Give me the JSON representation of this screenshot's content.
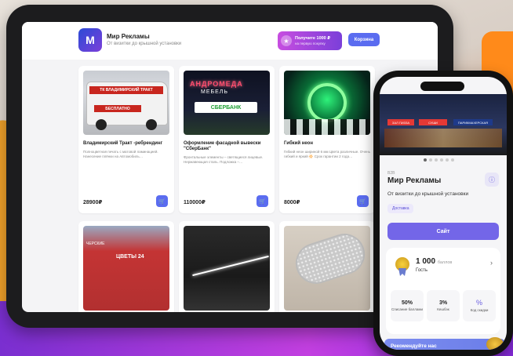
{
  "header": {
    "logo_letter": "М",
    "brand_name": "Мир Рекламы",
    "brand_sub": "От визитки до крышной установки",
    "promo_line1": "Получите 1000 ₽",
    "promo_line2": "на первую покупку",
    "cart_label": "Корзина"
  },
  "products": [
    {
      "title": "Владимирский Тракт -ребрендинг",
      "desc": "Полноцветная печать с матовой ламинацией. Нанесение плёнки на Автомобиль…",
      "price": "28900₽",
      "img_text1": "ТК ВЛАДИМИРСКИЙ ТРАКТ",
      "img_text2": "БЕСПЛАТНО"
    },
    {
      "title": "Оформление фасадной вывески \"СберБанк\"",
      "desc": "Фронтальные элементы – светящиеся лицевые. Нержавеющая сталь. Подложка –…",
      "price": "110000₽",
      "img_text1": "АНДРОМЕДА",
      "img_text2": "МЕБЕЛЬ",
      "img_text3": "СБЕРБАНК"
    },
    {
      "title": "Гибкий неон",
      "desc": "Гибкий неон шириной 6 мм Цвета различные. Очень гибкий и яркий 🔆 Срок гарантии 2 года…",
      "price": "8000₽"
    },
    {
      "title": "",
      "img_text1": "ЦВЕТЫ 24",
      "img_text2": "ЧЕРСКИЕ"
    },
    {
      "title": ""
    },
    {
      "title": ""
    }
  ],
  "phone": {
    "img_signs": [
      "ЗАЛ ПИЗЗА",
      "СУШИ",
      "ПАРИКМАХЕРСКАЯ"
    ],
    "b2b_label": "B2B",
    "name": "Мир Рекламы",
    "subtitle": "От визитки до крышной установки",
    "tag": "Доставка",
    "site_button": "Сайт",
    "points_value": "1 000",
    "points_unit": "баллов",
    "points_level": "Гость",
    "tiles": [
      {
        "value": "50%",
        "label": "Списание баллами"
      },
      {
        "value": "3%",
        "label": "Кешбэк"
      },
      {
        "value": "",
        "label": "Код скидки"
      }
    ],
    "recommend": "Рекомендуйте нас"
  },
  "icons": {
    "cart": "cart-icon",
    "info": "info-icon",
    "chevron": "chevron-right-icon",
    "star": "star-icon"
  }
}
